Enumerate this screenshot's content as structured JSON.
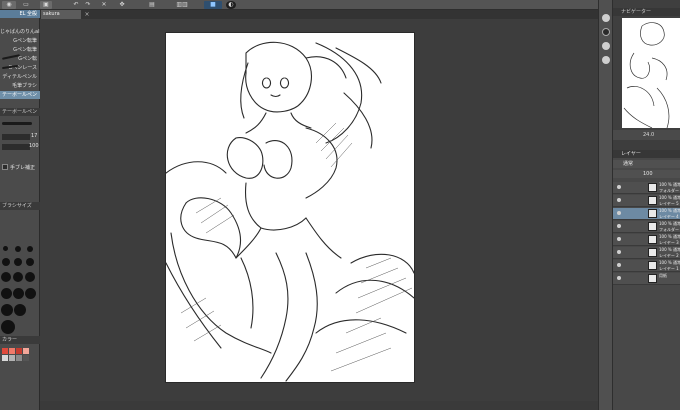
{
  "toolbar": {
    "items": [
      "view-icon",
      "canvas-icon",
      "save-icon",
      "undo-icon",
      "redo-icon",
      "clear-icon",
      "transform-icon",
      "ruler-icon",
      "snap-icon",
      "color-icon",
      "help-icon"
    ]
  },
  "document_tab": {
    "label": "sakura",
    "close": "×"
  },
  "left_panel": {
    "tool_header": "EL 全般",
    "brushes": [
      {
        "label": "じゃばんのりんalie"
      },
      {
        "label": "Gペン転筆"
      },
      {
        "label": "Gペン転筆"
      },
      {
        "label": "Gペン転"
      },
      {
        "label": "Gペンレース"
      },
      {
        "label": "ディテルペンル"
      },
      {
        "label": "毛筆ブラシ"
      },
      {
        "label": "テーボールペン"
      }
    ],
    "sub_tool_header": "テーボールペン",
    "size_value": "17",
    "opacity_value": "100",
    "stabilizer_label": "手ブレ補正",
    "brush_size_header": "ブラシサイズ",
    "color_header": "カラー"
  },
  "colors": {
    "accent": "#6f8fa8",
    "swatches": [
      "#e04a3c",
      "#f07a6a",
      "#c43b2f",
      "#f3a79a",
      "#d9d9d9",
      "#b3b3b3",
      "#8a8a8a",
      "#555555"
    ]
  },
  "navigator": {
    "header": "ナビゲーター",
    "zoom": "24.0"
  },
  "layers": {
    "header": "レイヤー",
    "blend_mode": "通常",
    "opacity": "100",
    "rows": [
      {
        "line1": "100 % 通常",
        "line2": "フォルダー 1"
      },
      {
        "line1": "100 % 通常",
        "line2": "レイヤー 5"
      },
      {
        "line1": "100 % 通常",
        "line2": "レイヤー 4"
      },
      {
        "line1": "100 % 通常",
        "line2": "フォルダー 1"
      },
      {
        "line1": "100 % 通常",
        "line2": "レイヤー 3"
      },
      {
        "line1": "100 % 通常",
        "line2": "レイヤー 2"
      },
      {
        "line1": "100 % 通常",
        "line2": "レイヤー 1"
      },
      {
        "line1": "",
        "line2": "用紙"
      }
    ]
  }
}
